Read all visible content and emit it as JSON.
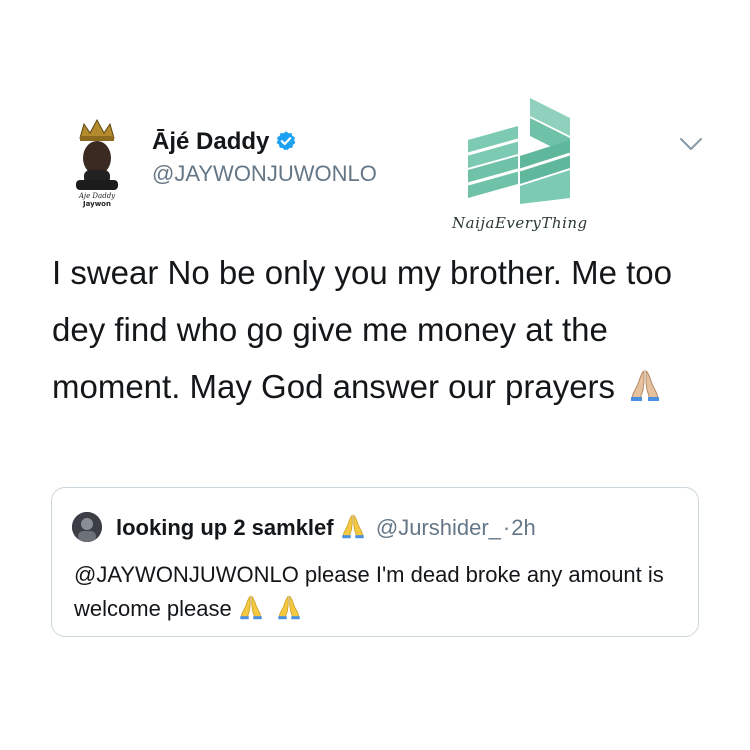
{
  "tweet": {
    "display_name": "Ājé Daddy",
    "handle": "@JAYWONJUWONLO",
    "avatar_text": "Aje Daddy Jaywon",
    "text": "I swear No be only you my brother. Me too dey find who go give me money at the moment.  May God answer our prayers",
    "emoji_icon": "folded-hands"
  },
  "watermark": {
    "text": "NaijaEveryThing"
  },
  "quote": {
    "name": "looking up 2 samklef",
    "handle": "@Jurshider_",
    "separator": "·",
    "time": "2h",
    "text": "@JAYWONJUWONLO please I'm dead broke any amount is welcome please"
  },
  "colors": {
    "text": "#14171a",
    "secondary": "#657786",
    "verified": "#1da1f2",
    "border": "#ccd6dd",
    "watermark": "#6fc2a8"
  }
}
